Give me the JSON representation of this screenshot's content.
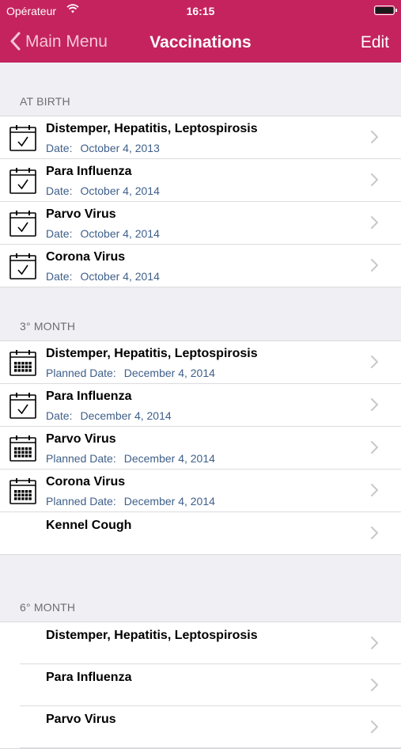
{
  "status_bar": {
    "carrier": "Opérateur",
    "time": "16:15"
  },
  "nav": {
    "back_label": "Main Menu",
    "title": "Vaccinations",
    "edit_label": "Edit"
  },
  "sections": [
    {
      "header": "AT BIRTH",
      "rows": [
        {
          "title": "Distemper, Hepatitis, Leptospirosis",
          "date_label": "Date:",
          "date": "October 4, 2013",
          "icon": "calendar-check-icon"
        },
        {
          "title": "Para Influenza",
          "date_label": "Date:",
          "date": "October 4, 2014",
          "icon": "calendar-check-icon"
        },
        {
          "title": "Parvo Virus",
          "date_label": "Date:",
          "date": "October 4, 2014",
          "icon": "calendar-check-icon"
        },
        {
          "title": "Corona Virus",
          "date_label": "Date:",
          "date": "October 4, 2014",
          "icon": "calendar-check-icon"
        }
      ]
    },
    {
      "header": "3° MONTH",
      "rows": [
        {
          "title": "Distemper, Hepatitis, Leptospirosis",
          "date_label": "Planned Date:",
          "date": "December 4, 2014",
          "icon": "calendar-grid-icon"
        },
        {
          "title": "Para Influenza",
          "date_label": "Date:",
          "date": "December 4, 2014",
          "icon": "calendar-check-icon"
        },
        {
          "title": "Parvo Virus",
          "date_label": "Planned Date:",
          "date": "December 4, 2014",
          "icon": "calendar-grid-icon"
        },
        {
          "title": "Corona Virus",
          "date_label": "Planned Date:",
          "date": "December 4, 2014",
          "icon": "calendar-grid-icon"
        },
        {
          "title": "Kennel Cough"
        }
      ]
    },
    {
      "header": "6° MONTH",
      "rows": [
        {
          "title": "Distemper, Hepatitis, Leptospirosis"
        },
        {
          "title": "Para Influenza"
        },
        {
          "title": "Parvo Virus"
        }
      ]
    }
  ],
  "colors": {
    "nav_bar": "#c4235e",
    "subtitle": "#3e5f8a",
    "back_button": "#f5c6d6"
  }
}
